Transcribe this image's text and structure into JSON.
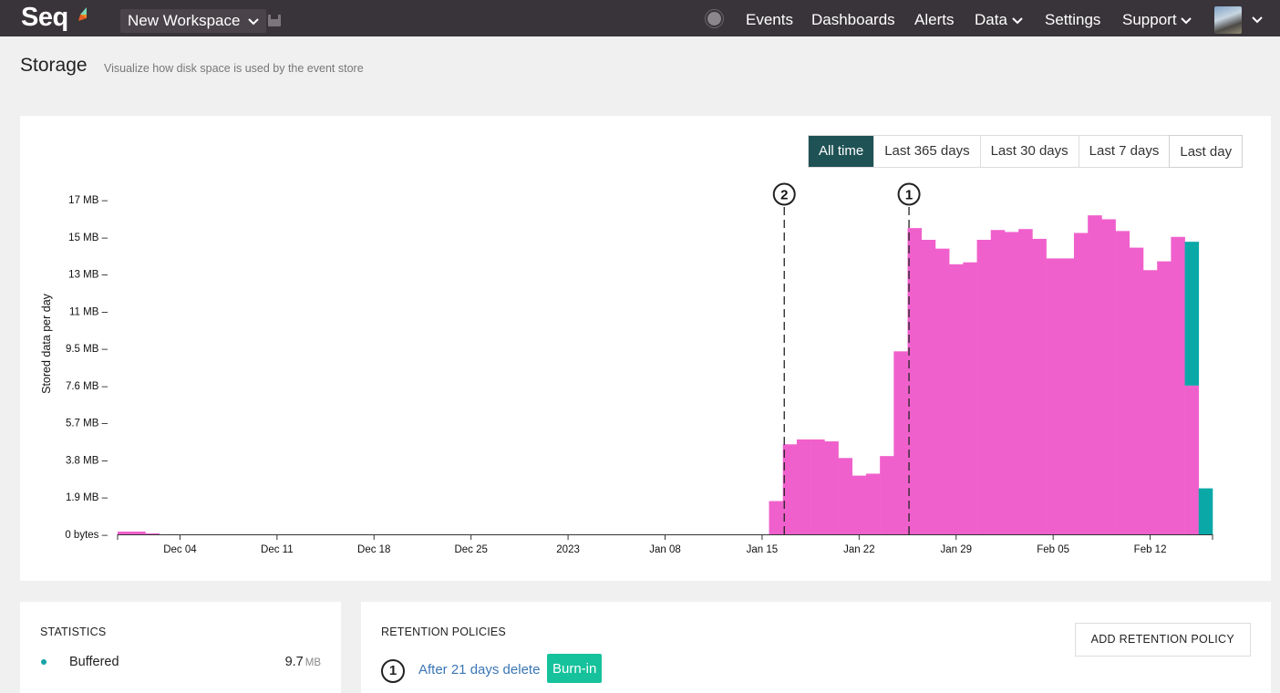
{
  "topbar": {
    "logo": "Seq",
    "workspace": "New Workspace",
    "nav": [
      {
        "label": "Events",
        "dropdown": false
      },
      {
        "label": "Dashboards",
        "dropdown": false
      },
      {
        "label": "Alerts",
        "dropdown": false
      },
      {
        "label": "Data",
        "dropdown": true
      },
      {
        "label": "Settings",
        "dropdown": false
      },
      {
        "label": "Support",
        "dropdown": true
      }
    ],
    "chevron": "⌄"
  },
  "page": {
    "title": "Storage",
    "subtitle": "Visualize how disk space is used by the event store"
  },
  "range_buttons": [
    {
      "label": "All time",
      "active": true
    },
    {
      "label": "Last 365 days",
      "active": false
    },
    {
      "label": "Last 30 days",
      "active": false
    },
    {
      "label": "Last 7 days",
      "active": false
    },
    {
      "label": "Last day",
      "active": false
    }
  ],
  "colors": {
    "stored": "#f060cc",
    "buffered": "#0ba8a8",
    "active_range": "#1f5255",
    "badge": "#16c29b",
    "link": "#3b76b6"
  },
  "chart_data": {
    "type": "bar",
    "stacked": true,
    "ylabel": "Stored data per day",
    "xlabel": "",
    "y_unit": "MB",
    "ylim": [
      0,
      17.1
    ],
    "y_ticks": [
      {
        "value": 0,
        "label": "0 bytes"
      },
      {
        "value": 1.9,
        "label": "1.9 MB"
      },
      {
        "value": 3.8,
        "label": "3.8 MB"
      },
      {
        "value": 5.7,
        "label": "5.7 MB"
      },
      {
        "value": 7.6,
        "label": "7.6 MB"
      },
      {
        "value": 9.5,
        "label": "9.5 MB"
      },
      {
        "value": 11.4,
        "label": "11 MB"
      },
      {
        "value": 13.3,
        "label": "13 MB"
      },
      {
        "value": 15.2,
        "label": "15 MB"
      },
      {
        "value": 17.1,
        "label": "17 MB"
      }
    ],
    "x_start_day": 0,
    "x_end_day": 79,
    "x_ticks": [
      {
        "day": 4.5,
        "label": "Dec 04"
      },
      {
        "day": 11.5,
        "label": "Dec 11"
      },
      {
        "day": 18.5,
        "label": "Dec 18"
      },
      {
        "day": 25.5,
        "label": "Dec 25"
      },
      {
        "day": 32.5,
        "label": "2023"
      },
      {
        "day": 39.5,
        "label": "Jan 08"
      },
      {
        "day": 46.5,
        "label": "Jan 15"
      },
      {
        "day": 53.5,
        "label": "Jan 22"
      },
      {
        "day": 60.5,
        "label": "Jan 29"
      },
      {
        "day": 67.5,
        "label": "Feb 05"
      },
      {
        "day": 74.5,
        "label": "Feb 12"
      }
    ],
    "series": [
      {
        "name": "Stored",
        "bars": [
          {
            "day": 0,
            "span": 2,
            "value": 0.14
          },
          {
            "day": 2,
            "span": 1,
            "value": 0.05
          },
          {
            "day": 47,
            "value": 1.7
          },
          {
            "day": 48,
            "value": 4.6
          },
          {
            "day": 49,
            "value": 4.85
          },
          {
            "day": 50,
            "value": 4.85
          },
          {
            "day": 51,
            "value": 4.75
          },
          {
            "day": 52,
            "value": 3.9
          },
          {
            "day": 53,
            "value": 3.0
          },
          {
            "day": 54,
            "value": 3.1
          },
          {
            "day": 55,
            "value": 4.0
          },
          {
            "day": 56,
            "value": 9.35
          },
          {
            "day": 57,
            "value": 15.65
          },
          {
            "day": 58,
            "value": 15.05
          },
          {
            "day": 59,
            "value": 14.6
          },
          {
            "day": 60,
            "value": 13.8
          },
          {
            "day": 61,
            "value": 13.9
          },
          {
            "day": 62,
            "value": 15.05
          },
          {
            "day": 63,
            "value": 15.55
          },
          {
            "day": 64,
            "value": 15.45
          },
          {
            "day": 65,
            "value": 15.6
          },
          {
            "day": 66,
            "value": 15.1
          },
          {
            "day": 67,
            "value": 14.1
          },
          {
            "day": 68,
            "value": 14.1
          },
          {
            "day": 69,
            "value": 15.4
          },
          {
            "day": 70,
            "value": 16.3
          },
          {
            "day": 71,
            "value": 16.1
          },
          {
            "day": 72,
            "value": 15.5
          },
          {
            "day": 73,
            "value": 14.65
          },
          {
            "day": 74,
            "value": 13.5
          },
          {
            "day": 75,
            "value": 13.95
          },
          {
            "day": 76,
            "value": 15.2
          },
          {
            "day": 77,
            "value": 7.6
          }
        ]
      },
      {
        "name": "Buffered",
        "bars": [
          {
            "day": 77,
            "value": 7.35
          },
          {
            "day": 78,
            "value": 2.35
          }
        ]
      }
    ],
    "markers": [
      {
        "label": "2",
        "day": 48.1
      },
      {
        "label": "1",
        "day": 57.1
      }
    ],
    "grid": false,
    "legend": "none"
  },
  "statistics": {
    "heading": "STATISTICS",
    "items": [
      {
        "label": "Buffered",
        "value": "9.7",
        "unit": "MB"
      }
    ]
  },
  "retention": {
    "heading": "RETENTION POLICIES",
    "add_label": "ADD RETENTION POLICY",
    "policies": [
      {
        "number": "1",
        "text": "After 21 days delete",
        "badge": "Burn-in"
      }
    ]
  }
}
